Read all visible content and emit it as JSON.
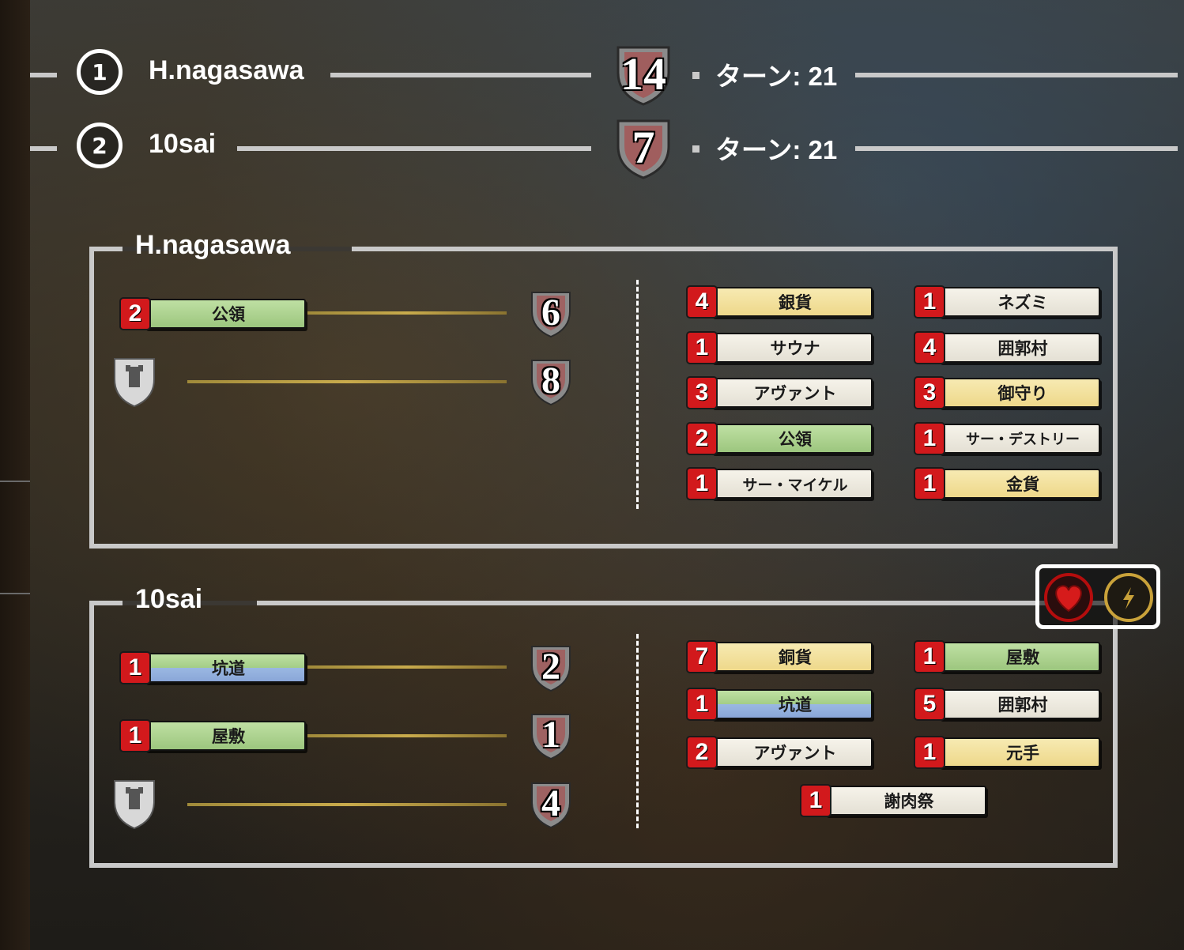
{
  "ranking": [
    {
      "rank": "1",
      "name": "H.nagasawa",
      "score": "14",
      "turns": "ターン: 21"
    },
    {
      "rank": "2",
      "name": "10sai",
      "score": "7",
      "turns": "ターン: 21"
    }
  ],
  "players": [
    {
      "name": "H.nagasawa",
      "vp_rows": [
        {
          "count": "2",
          "card": "公領",
          "color": "green",
          "points": "6"
        },
        {
          "icon": "castle-token-icon",
          "points": "8"
        }
      ],
      "deck": [
        {
          "count": "4",
          "card": "銀貨",
          "color": "yellow"
        },
        {
          "count": "1",
          "card": "ネズミ",
          "color": "white"
        },
        {
          "count": "1",
          "card": "サウナ",
          "color": "white"
        },
        {
          "count": "4",
          "card": "囲郭村",
          "color": "white"
        },
        {
          "count": "3",
          "card": "アヴァント",
          "color": "white"
        },
        {
          "count": "3",
          "card": "御守り",
          "color": "yellow"
        },
        {
          "count": "2",
          "card": "公領",
          "color": "green"
        },
        {
          "count": "1",
          "card": "サー・デストリー",
          "color": "white"
        },
        {
          "count": "1",
          "card": "サー・マイケル",
          "color": "white"
        },
        {
          "count": "1",
          "card": "金貨",
          "color": "yellow"
        }
      ]
    },
    {
      "name": "10sai",
      "vp_rows": [
        {
          "count": "1",
          "card": "坑道",
          "color": "greenblue",
          "points": "2"
        },
        {
          "count": "1",
          "card": "屋敷",
          "color": "green",
          "points": "1"
        },
        {
          "icon": "castle-token-icon",
          "points": "4"
        }
      ],
      "deck": [
        {
          "count": "7",
          "card": "銅貨",
          "color": "yellow"
        },
        {
          "count": "1",
          "card": "屋敷",
          "color": "green"
        },
        {
          "count": "1",
          "card": "坑道",
          "color": "greenblue"
        },
        {
          "count": "5",
          "card": "囲郭村",
          "color": "white"
        },
        {
          "count": "2",
          "card": "アヴァント",
          "color": "white"
        },
        {
          "count": "1",
          "card": "元手",
          "color": "yellow"
        },
        {
          "count": "1",
          "card": "謝肉祭",
          "color": "white"
        }
      ]
    }
  ],
  "icons": {
    "heart": "heart-icon",
    "bolt": "lightning-icon"
  },
  "colors": {
    "red": "#d2191c",
    "frame": "#c9c9c9",
    "gold": "#c9a23a"
  }
}
